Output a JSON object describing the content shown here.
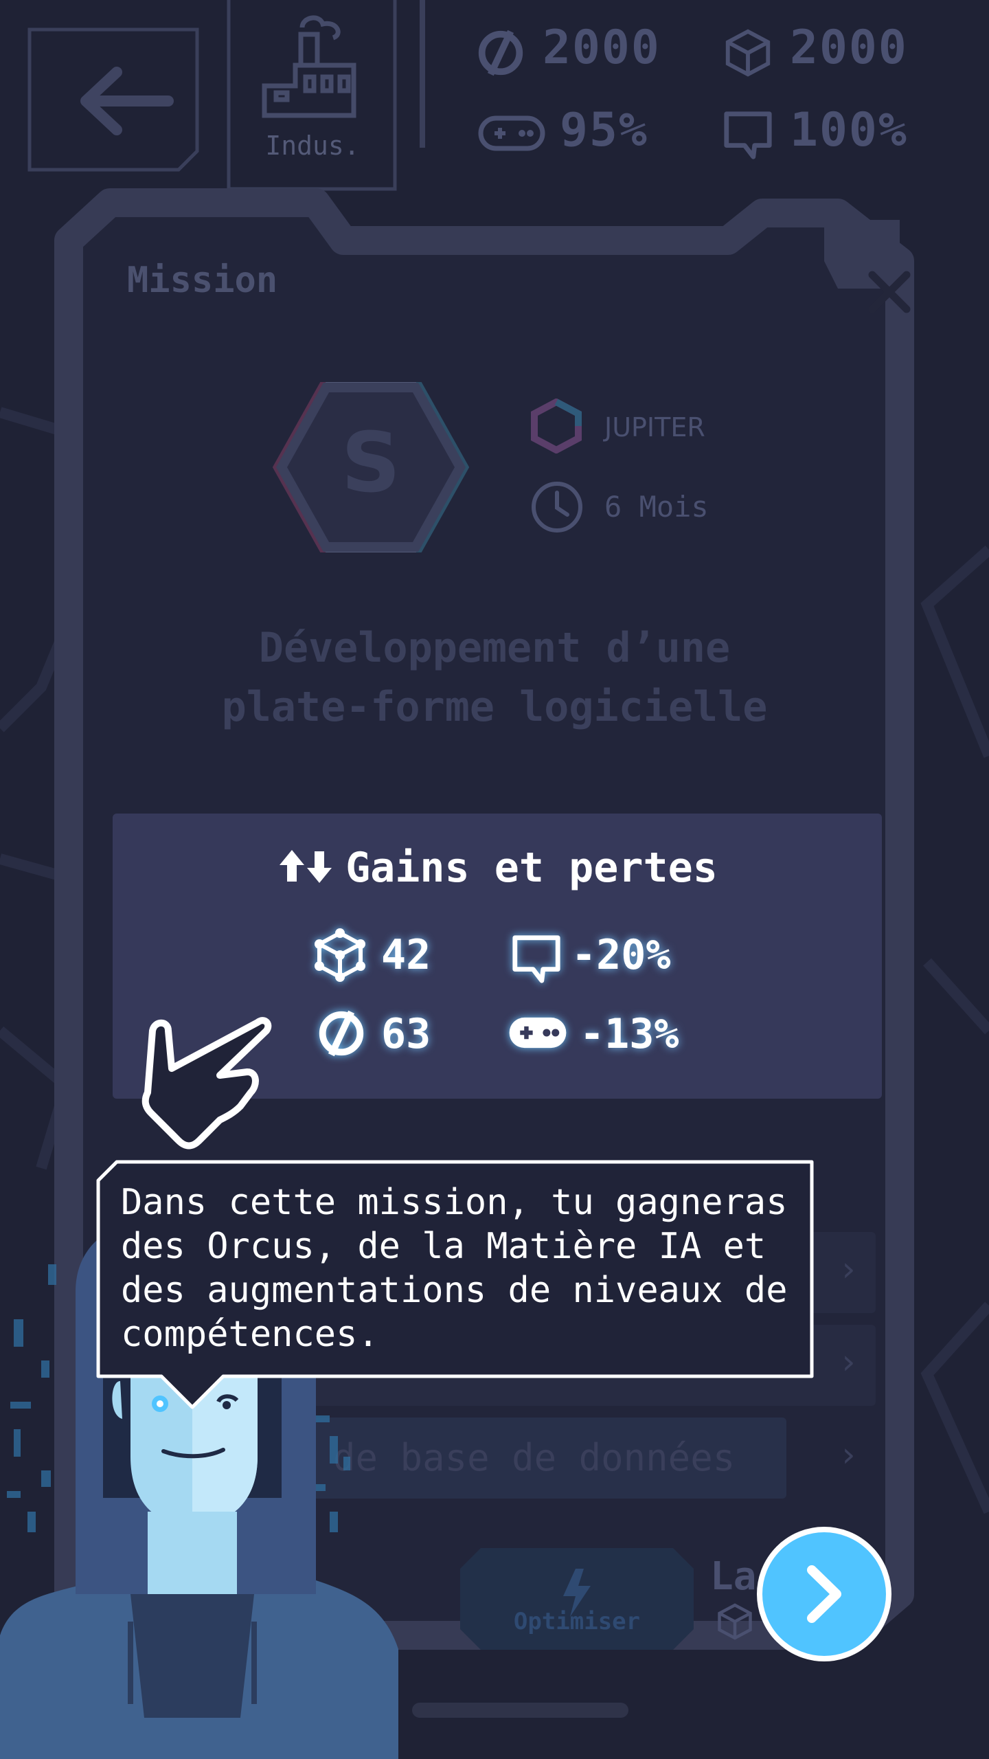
{
  "top_stats": {
    "orcus": "2000",
    "matter": "2000",
    "gameplay": "95%",
    "communication": "100%"
  },
  "building": {
    "label": "Indus."
  },
  "mission": {
    "title": "Mission",
    "badge_letter": "S",
    "client": "JUPITER",
    "duration": "6 Mois",
    "name_line1": "Développement d’une",
    "name_line2": "plate-forme logicielle"
  },
  "gains": {
    "title": "Gains et pertes",
    "items": [
      {
        "icon": "cube-icon",
        "value": "42"
      },
      {
        "icon": "chat-bubble-icon",
        "value": "-20%"
      },
      {
        "icon": "orcus-icon",
        "value": "63"
      },
      {
        "icon": "gamepad-icon",
        "value": "-13%"
      }
    ]
  },
  "rows": {
    "row3_text": "n de base de données"
  },
  "actions": {
    "optimize_label": "Optimiser",
    "launch_label": "La"
  },
  "tutorial": {
    "text": "Dans cette mission, tu gagneras des Orcus, de la Matière IA et des augmentations de niveaux de compétences."
  },
  "colors": {
    "background": "#1f2235",
    "card": "#36395a",
    "accent": "#50c4ff",
    "glow": "#78c8ff"
  }
}
